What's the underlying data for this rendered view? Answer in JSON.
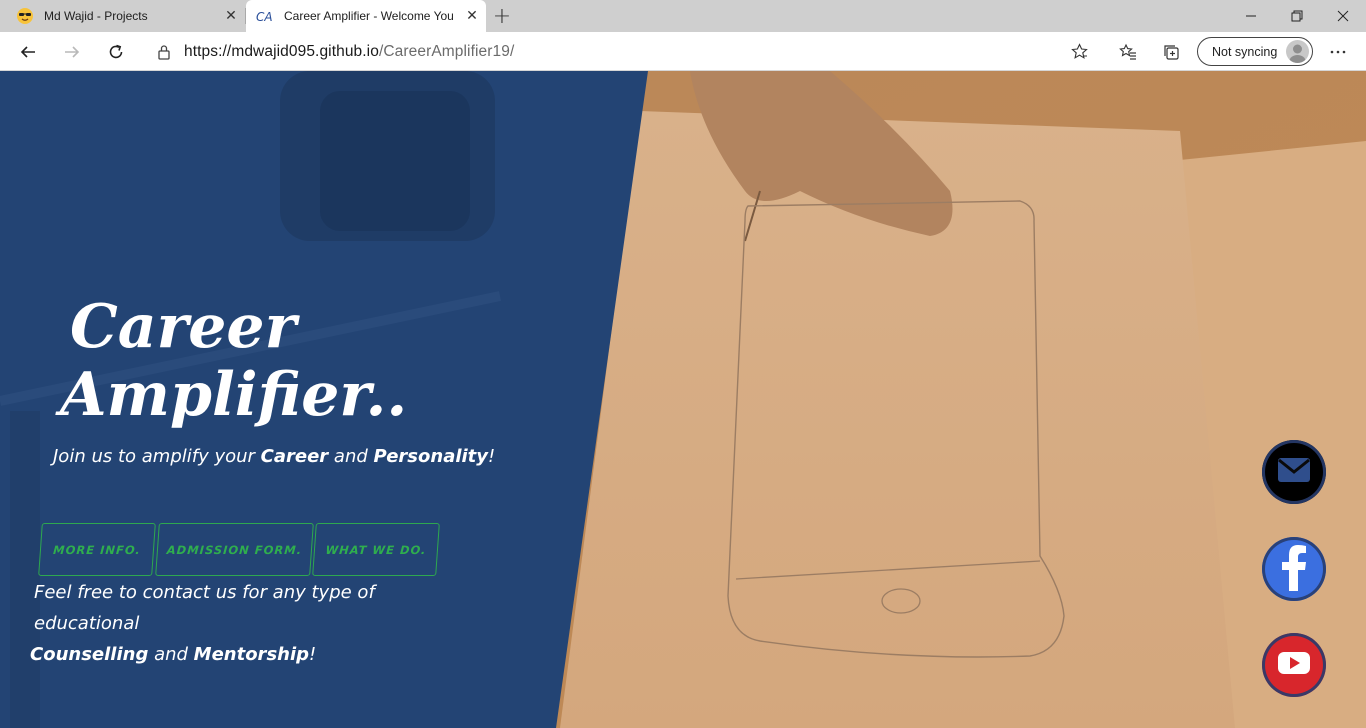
{
  "browser": {
    "tabs": [
      {
        "title": "Md Wajid - Projects",
        "active": false,
        "favicon": "sunglasses-emoji-icon"
      },
      {
        "title": "Career Amplifier - Welcome You",
        "active": true,
        "favicon": "ca-logo-icon"
      }
    ],
    "address": {
      "host": "https://mdwajid095.github.io",
      "path": "/CareerAmplifier19/"
    },
    "sync_label": "Not syncing"
  },
  "hero": {
    "title_line1": "Career",
    "title_line2": "Amplifier..",
    "tagline_pre": "Join us to amplify your ",
    "tagline_b1": "Career",
    "tagline_mid": " and ",
    "tagline_b2": "Personality",
    "tagline_end": "!"
  },
  "buttons": [
    {
      "label": "MORE INFO."
    },
    {
      "label": "ADMISSION FORM."
    },
    {
      "label": "WHAT WE DO."
    }
  ],
  "contact": {
    "line1": "Feel free to contact us for any type of educational",
    "b1": "Counselling",
    "mid": " and ",
    "b2": "Mentorship",
    "end": "!"
  },
  "social": [
    {
      "name": "email",
      "icon": "mail-icon",
      "color": "#000000"
    },
    {
      "name": "facebook",
      "icon": "facebook-icon",
      "color": "#3b6fe0"
    },
    {
      "name": "youtube",
      "icon": "youtube-icon",
      "color": "#d8262c"
    }
  ],
  "colors": {
    "accent_green": "#2fae4e",
    "panel_blue": "#244673"
  }
}
